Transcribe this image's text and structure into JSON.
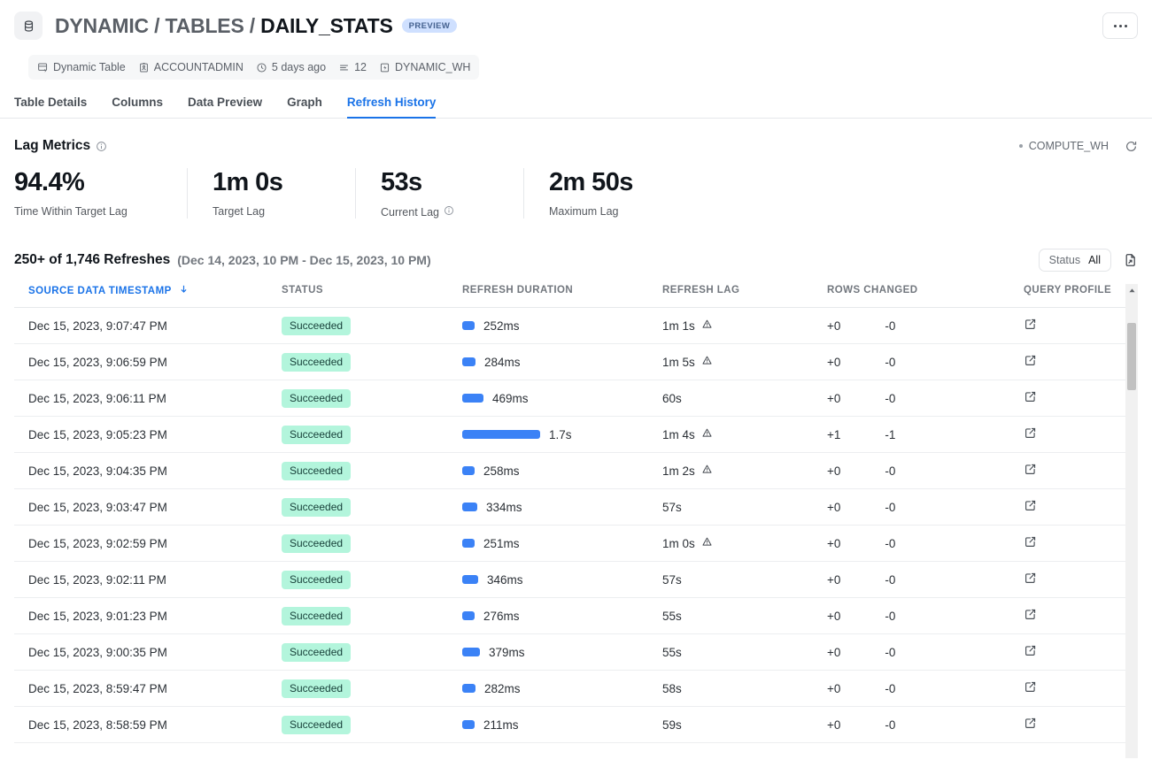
{
  "header": {
    "object_icon": "database-table-icon",
    "breadcrumb_prefix": "DYNAMIC / TABLES / ",
    "object_name": "DAILY_STATS",
    "preview_badge": "PREVIEW",
    "overflow_menu": "more-options"
  },
  "meta": {
    "items": [
      {
        "icon": "dynamic-table-icon",
        "label": "Dynamic Table"
      },
      {
        "icon": "owner-badge-icon",
        "label": "ACCOUNTADMIN"
      },
      {
        "icon": "clock-icon",
        "label": "5 days ago"
      },
      {
        "icon": "rows-icon",
        "label": "12"
      },
      {
        "icon": "warehouse-icon",
        "label": "DYNAMIC_WH"
      }
    ]
  },
  "tabs": [
    {
      "label": "Table Details",
      "active": false
    },
    {
      "label": "Columns",
      "active": false
    },
    {
      "label": "Data Preview",
      "active": false
    },
    {
      "label": "Graph",
      "active": false
    },
    {
      "label": "Refresh History",
      "active": true
    }
  ],
  "lag_metrics": {
    "title": "Lag Metrics",
    "info_icon": "info-icon",
    "warehouse": "COMPUTE_WH",
    "refresh_icon": "refresh-icon",
    "metrics": [
      {
        "value": "94.4%",
        "label": "Time Within Target Lag",
        "info": false
      },
      {
        "value": "1m 0s",
        "label": "Target Lag",
        "info": false
      },
      {
        "value": "53s",
        "label": "Current Lag",
        "info": true
      },
      {
        "value": "2m 50s",
        "label": "Maximum Lag",
        "info": false
      }
    ]
  },
  "refreshes": {
    "count_label": "250+ of 1,746 Refreshes",
    "range_label": "(Dec 14, 2023, 10 PM - Dec 15, 2023, 10 PM)",
    "status_filter": {
      "key": "Status",
      "value": "All"
    },
    "export_icon": "export-icon",
    "columns": [
      {
        "key": "timestamp",
        "label": "SOURCE DATA TIMESTAMP",
        "sorted": true,
        "sort_dir": "desc"
      },
      {
        "key": "status",
        "label": "STATUS",
        "sorted": false
      },
      {
        "key": "duration",
        "label": "REFRESH DURATION",
        "sorted": false
      },
      {
        "key": "lag",
        "label": "REFRESH LAG",
        "sorted": false
      },
      {
        "key": "rows",
        "label": "ROWS CHANGED",
        "sorted": false
      },
      {
        "key": "query_profile",
        "label": "QUERY PROFILE",
        "sorted": false
      }
    ],
    "rows": [
      {
        "timestamp": "Dec 15, 2023, 9:07:47 PM",
        "status": "Succeeded",
        "duration": "252ms",
        "duration_ms": 252,
        "lag": "1m 1s",
        "lag_warning": true,
        "rows_added": "+0",
        "rows_removed": "-0",
        "query_profile_icon": "external-link-icon"
      },
      {
        "timestamp": "Dec 15, 2023, 9:06:59 PM",
        "status": "Succeeded",
        "duration": "284ms",
        "duration_ms": 284,
        "lag": "1m 5s",
        "lag_warning": true,
        "rows_added": "+0",
        "rows_removed": "-0",
        "query_profile_icon": "external-link-icon"
      },
      {
        "timestamp": "Dec 15, 2023, 9:06:11 PM",
        "status": "Succeeded",
        "duration": "469ms",
        "duration_ms": 469,
        "lag": "60s",
        "lag_warning": false,
        "rows_added": "+0",
        "rows_removed": "-0",
        "query_profile_icon": "external-link-icon"
      },
      {
        "timestamp": "Dec 15, 2023, 9:05:23 PM",
        "status": "Succeeded",
        "duration": "1.7s",
        "duration_ms": 1700,
        "lag": "1m 4s",
        "lag_warning": true,
        "rows_added": "+1",
        "rows_removed": "-1",
        "query_profile_icon": "external-link-icon"
      },
      {
        "timestamp": "Dec 15, 2023, 9:04:35 PM",
        "status": "Succeeded",
        "duration": "258ms",
        "duration_ms": 258,
        "lag": "1m 2s",
        "lag_warning": true,
        "rows_added": "+0",
        "rows_removed": "-0",
        "query_profile_icon": "external-link-icon"
      },
      {
        "timestamp": "Dec 15, 2023, 9:03:47 PM",
        "status": "Succeeded",
        "duration": "334ms",
        "duration_ms": 334,
        "lag": "57s",
        "lag_warning": false,
        "rows_added": "+0",
        "rows_removed": "-0",
        "query_profile_icon": "external-link-icon"
      },
      {
        "timestamp": "Dec 15, 2023, 9:02:59 PM",
        "status": "Succeeded",
        "duration": "251ms",
        "duration_ms": 251,
        "lag": "1m 0s",
        "lag_warning": true,
        "rows_added": "+0",
        "rows_removed": "-0",
        "query_profile_icon": "external-link-icon"
      },
      {
        "timestamp": "Dec 15, 2023, 9:02:11 PM",
        "status": "Succeeded",
        "duration": "346ms",
        "duration_ms": 346,
        "lag": "57s",
        "lag_warning": false,
        "rows_added": "+0",
        "rows_removed": "-0",
        "query_profile_icon": "external-link-icon"
      },
      {
        "timestamp": "Dec 15, 2023, 9:01:23 PM",
        "status": "Succeeded",
        "duration": "276ms",
        "duration_ms": 276,
        "lag": "55s",
        "lag_warning": false,
        "rows_added": "+0",
        "rows_removed": "-0",
        "query_profile_icon": "external-link-icon"
      },
      {
        "timestamp": "Dec 15, 2023, 9:00:35 PM",
        "status": "Succeeded",
        "duration": "379ms",
        "duration_ms": 379,
        "lag": "55s",
        "lag_warning": false,
        "rows_added": "+0",
        "rows_removed": "-0",
        "query_profile_icon": "external-link-icon"
      },
      {
        "timestamp": "Dec 15, 2023, 8:59:47 PM",
        "status": "Succeeded",
        "duration": "282ms",
        "duration_ms": 282,
        "lag": "58s",
        "lag_warning": false,
        "rows_added": "+0",
        "rows_removed": "-0",
        "query_profile_icon": "external-link-icon"
      },
      {
        "timestamp": "Dec 15, 2023, 8:58:59 PM",
        "status": "Succeeded",
        "duration": "211ms",
        "duration_ms": 211,
        "lag": "59s",
        "lag_warning": false,
        "rows_added": "+0",
        "rows_removed": "-0",
        "query_profile_icon": "external-link-icon"
      }
    ]
  },
  "colors": {
    "accent": "#1a73e8",
    "bar": "#3b82f6",
    "success_bg": "#b3f5dc",
    "success_text": "#18413a",
    "preview_bg": "#cfe0ff"
  }
}
